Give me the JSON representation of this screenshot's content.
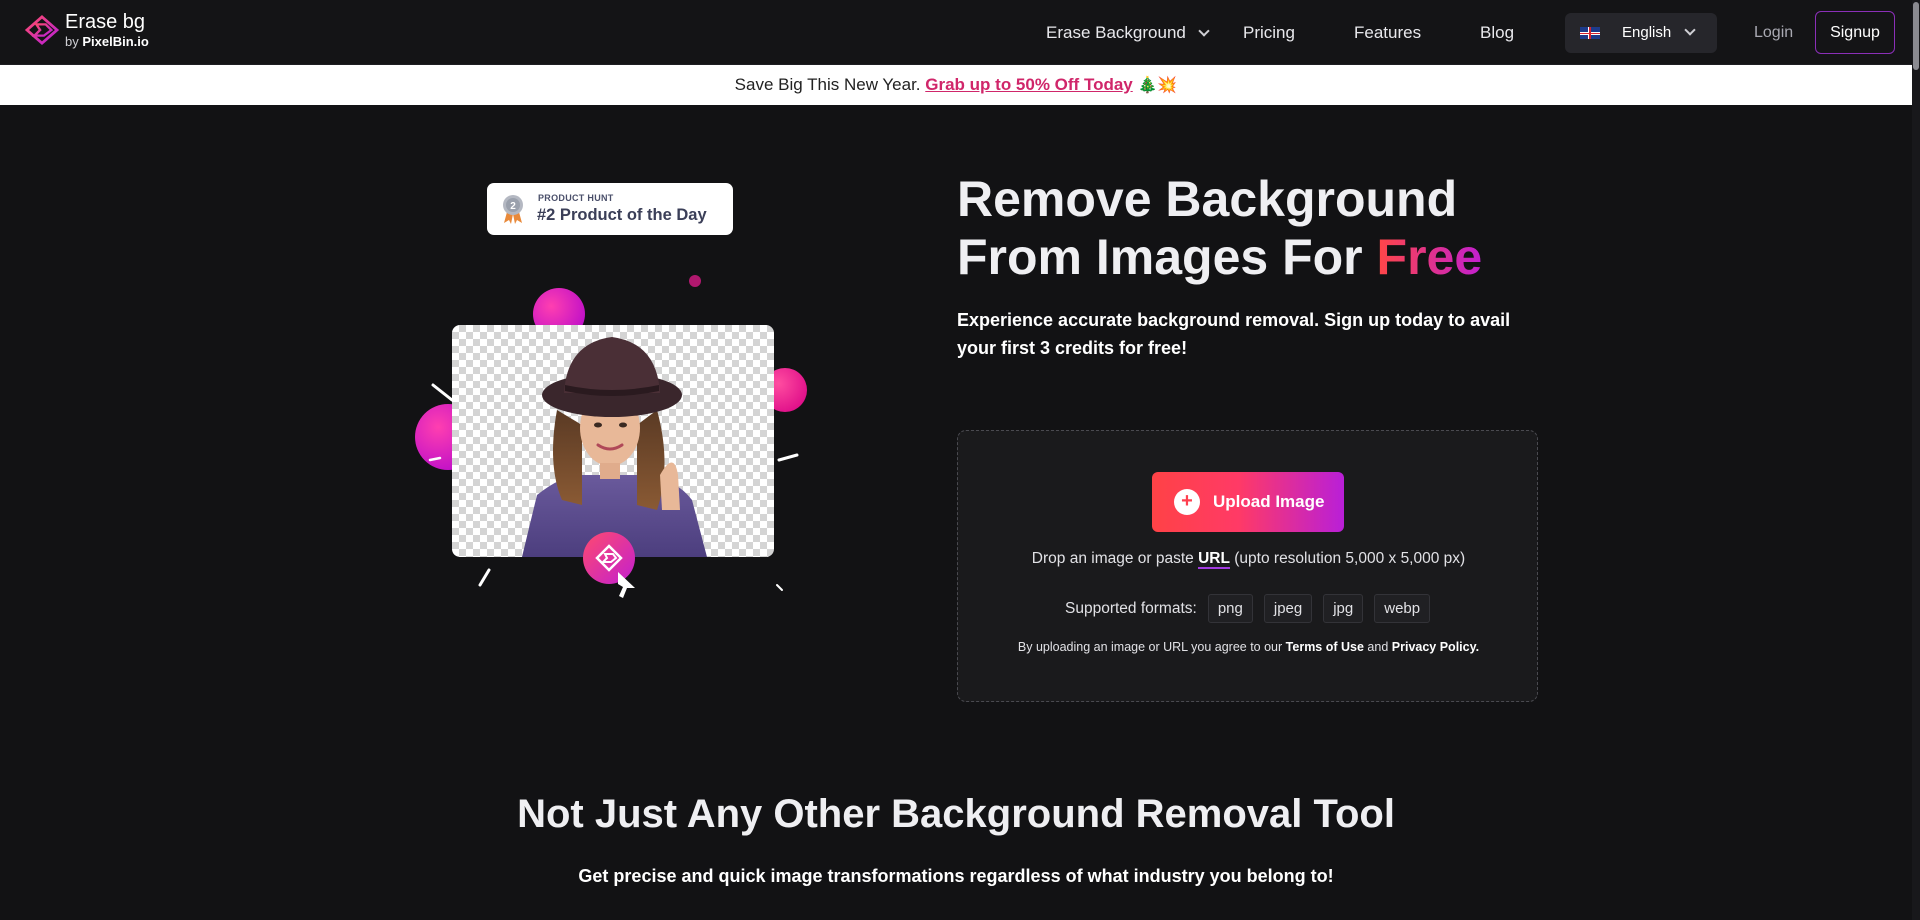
{
  "header": {
    "logo_title": "Erase bg",
    "logo_by": "by",
    "logo_brand": "PixelBin.io",
    "nav": [
      "Erase Background",
      "Pricing",
      "Features",
      "Blog"
    ],
    "language": "English",
    "login": "Login",
    "signup": "Signup"
  },
  "promo": {
    "text": "Save Big This New Year.",
    "link": "Grab up to 50% Off Today",
    "emoji": "🎄💥"
  },
  "badge": {
    "label": "PRODUCT HUNT",
    "title": "#2 Product of the Day",
    "medal_number": "2"
  },
  "hero": {
    "title_line1": "Remove Background",
    "title_line2_prefix": "From Images For ",
    "title_highlight": "Free",
    "subtitle": "Experience accurate background removal. Sign up today to avail your first 3 credits for free!"
  },
  "upload": {
    "button_label": "Upload Image",
    "drop_prefix": "Drop an image or paste",
    "drop_url": "URL",
    "drop_suffix": "(upto resolution 5,000 x 5,000 px)",
    "formats_label": "Supported formats:",
    "formats": [
      "png",
      "jpeg",
      "jpg",
      "webp"
    ],
    "terms_prefix": "By uploading an image or URL you agree to our",
    "terms_link": "Terms of Use",
    "terms_and": "and",
    "privacy_link": "Privacy Policy."
  },
  "section": {
    "title": "Not Just Any Other Background Removal Tool",
    "subtitle": "Get precise and quick image transformations regardless of what industry you belong to!"
  },
  "colors": {
    "accent_pink": "#d0266a",
    "gradient_start": "#ff4246",
    "gradient_end": "#b91fd8",
    "background": "#121214"
  }
}
